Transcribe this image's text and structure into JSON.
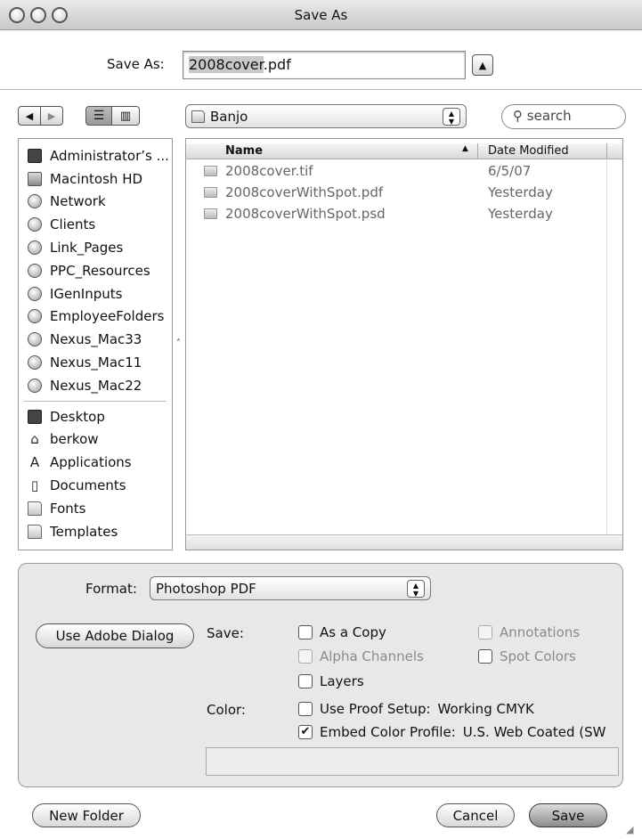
{
  "window": {
    "title": "Save As"
  },
  "save_as": {
    "label": "Save As:",
    "filename_base": "2008cover",
    "filename_ext": ".pdf",
    "expand_icon": "triangle-up"
  },
  "nav": {
    "back_icon": "triangle-left",
    "forward_icon": "triangle-right",
    "list_view_icon": "list-icon",
    "column_view_icon": "columns-icon"
  },
  "location": {
    "current": "Banjo"
  },
  "search": {
    "placeholder": "search"
  },
  "sidebar": {
    "devices": [
      {
        "label": "Administrator’s ...",
        "icon": "computer-icon"
      },
      {
        "label": "Macintosh HD",
        "icon": "disk-icon"
      },
      {
        "label": "Network",
        "icon": "network-icon"
      },
      {
        "label": "Clients",
        "icon": "server-icon"
      },
      {
        "label": "Link_Pages",
        "icon": "server-icon"
      },
      {
        "label": "PPC_Resources",
        "icon": "server-icon"
      },
      {
        "label": "IGenInputs",
        "icon": "server-icon"
      },
      {
        "label": "EmployeeFolders",
        "icon": "server-icon"
      },
      {
        "label": "Nexus_Mac33",
        "icon": "server-icon"
      },
      {
        "label": "Nexus_Mac11",
        "icon": "server-icon"
      },
      {
        "label": "Nexus_Mac22",
        "icon": "server-icon"
      }
    ],
    "places": [
      {
        "label": "Desktop",
        "icon": "desktop-icon"
      },
      {
        "label": "berkow",
        "icon": "home-icon"
      },
      {
        "label": "Applications",
        "icon": "applications-icon"
      },
      {
        "label": "Documents",
        "icon": "documents-icon"
      },
      {
        "label": "Fonts",
        "icon": "folder-icon"
      },
      {
        "label": "Templates",
        "icon": "folder-icon"
      }
    ]
  },
  "file_list": {
    "columns": [
      "Name",
      "Date Modified"
    ],
    "files": [
      {
        "name": "2008cover.tif",
        "date": "6/5/07"
      },
      {
        "name": "2008coverWithSpot.pdf",
        "date": "Yesterday"
      },
      {
        "name": "2008coverWithSpot.psd",
        "date": "Yesterday"
      }
    ]
  },
  "options": {
    "format_label": "Format:",
    "format_value": "Photoshop PDF",
    "use_adobe_dialog": "Use Adobe Dialog",
    "save_label": "Save:",
    "as_a_copy": "As a Copy",
    "annotations": "Annotations",
    "alpha_channels": "Alpha Channels",
    "spot_colors": "Spot Colors",
    "layers": "Layers",
    "color_label": "Color:",
    "use_proof_setup": "Use Proof Setup:",
    "proof_value": "Working CMYK",
    "embed_color_profile": "Embed Color Profile:",
    "profile_value": "U.S. Web Coated (SW"
  },
  "buttons": {
    "new_folder": "New Folder",
    "cancel": "Cancel",
    "save": "Save"
  }
}
